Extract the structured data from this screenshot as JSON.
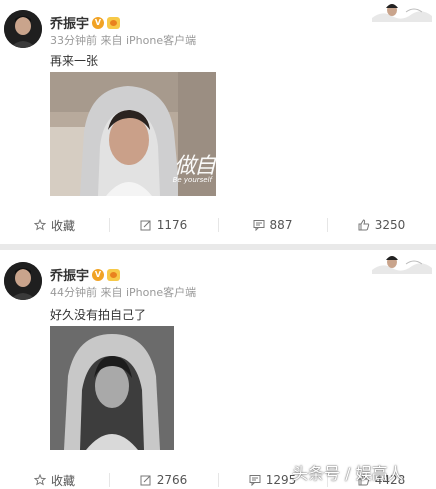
{
  "posts": [
    {
      "author": "乔振宇",
      "meta": "33分钟前 来自 iPhone客户端",
      "text": "再来一张",
      "photo_overlay_text": "做自",
      "photo_overlay_sub": "Be yourself",
      "actions": {
        "favorite": "收藏",
        "repost": "1176",
        "comment": "887",
        "like": "3250"
      }
    },
    {
      "author": "乔振宇",
      "meta": "44分钟前 来自 iPhone客户端",
      "text": "好久没有拍自己了",
      "actions": {
        "favorite": "收藏",
        "repost": "2766",
        "comment": "1295",
        "like": "4428"
      }
    }
  ],
  "watermark": "头条号 / 娱高人",
  "colors": {
    "meta_gray": "#999999",
    "vip_orange": "#f1a325",
    "separator": "#e9e9e9"
  },
  "icons": [
    "star-icon",
    "repost-icon",
    "comment-icon",
    "thumbs-up-icon",
    "verified-badge-icon",
    "vip-badge-icon"
  ]
}
